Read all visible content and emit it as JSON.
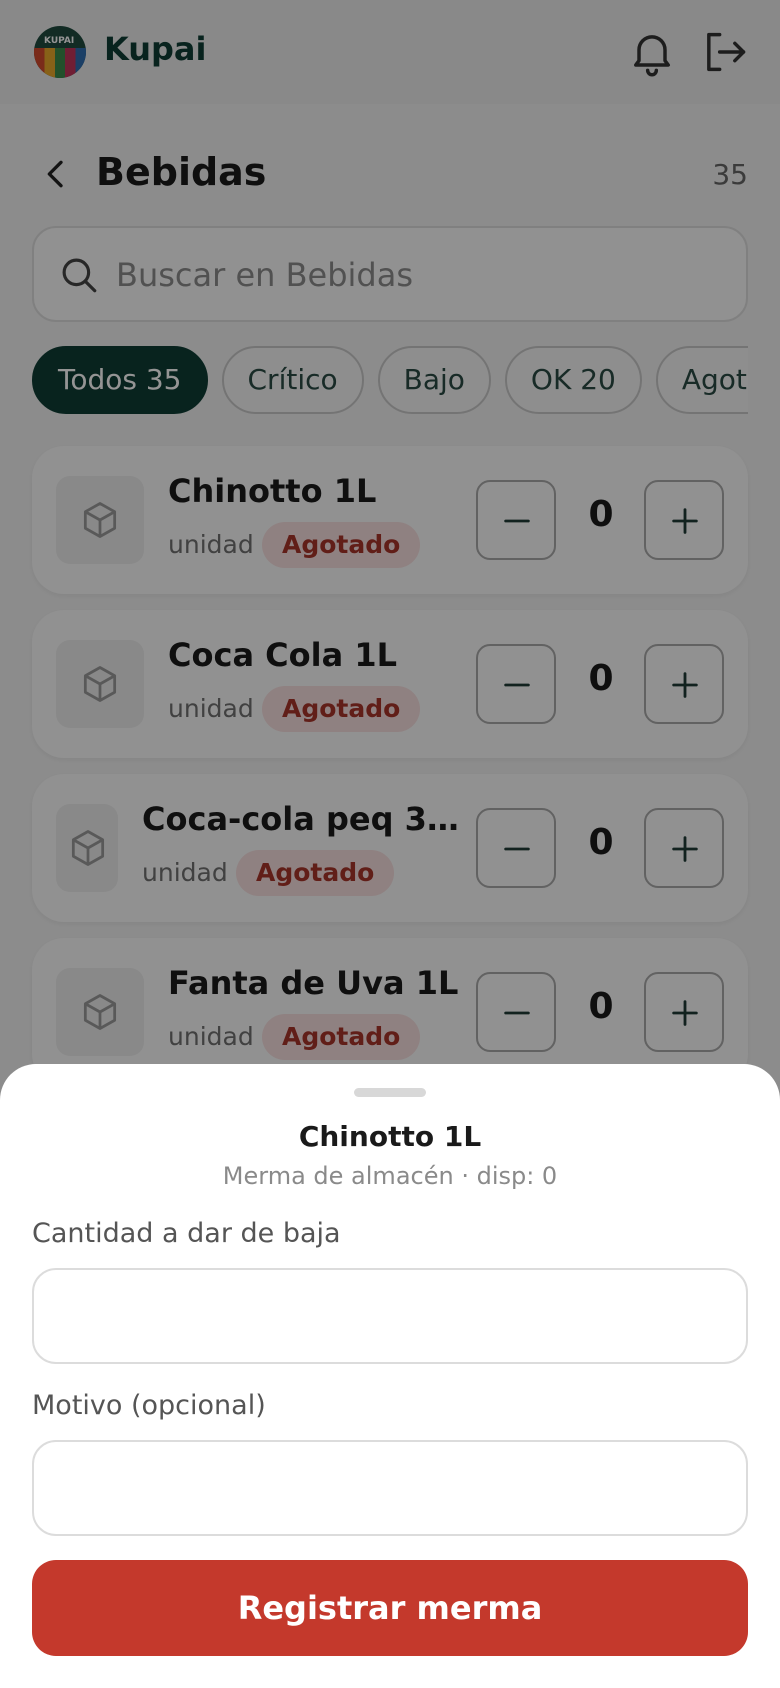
{
  "header": {
    "brand": "Kupai",
    "logo_text": "KUPAI"
  },
  "page": {
    "title": "Bebidas",
    "count": "35"
  },
  "search": {
    "placeholder": "Buscar en Bebidas"
  },
  "filters": [
    {
      "label": "Todos 35",
      "active": true
    },
    {
      "label": "Crítico",
      "active": false
    },
    {
      "label": "Bajo",
      "active": false
    },
    {
      "label": "OK 20",
      "active": false
    },
    {
      "label": "Agotado",
      "active": false
    }
  ],
  "products": [
    {
      "name": "Chinotto 1L",
      "unit": "unidad",
      "status": "Agotado",
      "qty": "0"
    },
    {
      "name": "Coca Cola 1L",
      "unit": "unidad",
      "status": "Agotado",
      "qty": "0"
    },
    {
      "name": "Coca-cola peq 3…",
      "unit": "unidad",
      "status": "Agotado",
      "qty": "0"
    },
    {
      "name": "Fanta de Uva 1L",
      "unit": "unidad",
      "status": "Agotado",
      "qty": "0"
    }
  ],
  "sheet": {
    "title": "Chinotto 1L",
    "subtitle": "Merma de almacén · disp: 0",
    "qty_label": "Cantidad a dar de baja",
    "qty_value": "",
    "reason_label": "Motivo (opcional)",
    "reason_value": "",
    "submit_label": "Registrar merma"
  },
  "colors": {
    "brand": "#0f3d34",
    "danger": "#c4392c",
    "badge_bg": "#f6dede",
    "badge_text": "#a8342a"
  },
  "icons": [
    "bell-icon",
    "logout-icon",
    "back-chevron-icon",
    "search-icon",
    "box-icon",
    "minus-icon",
    "plus-icon"
  ]
}
